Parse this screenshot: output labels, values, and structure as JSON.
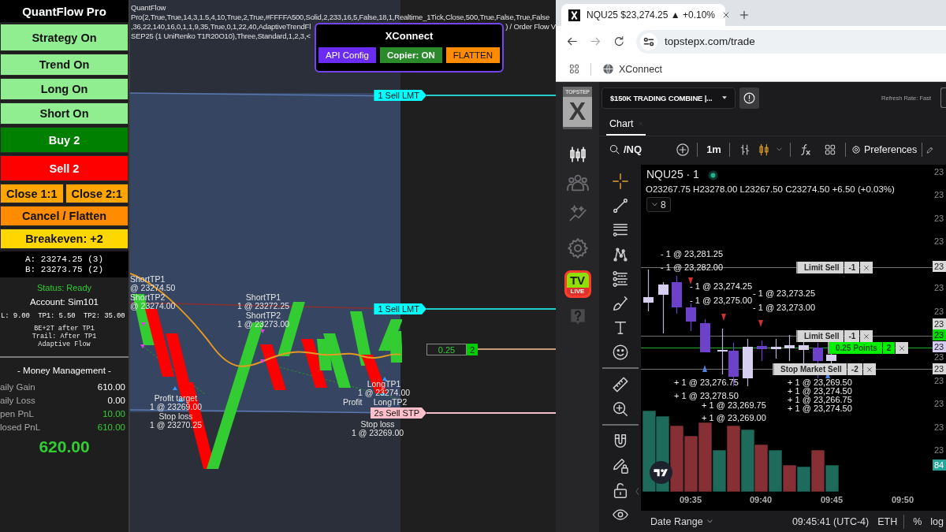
{
  "strategy_panel": {
    "title": "QuantFlow Pro",
    "button_rows": [
      {
        "buttons": [
          {
            "label": "Strategy On",
            "color": "#90ee90"
          }
        ]
      },
      {
        "buttons": [
          {
            "label": "Trend On",
            "color": "#90ee90"
          }
        ]
      },
      {
        "buttons": [
          {
            "label": "Long On",
            "color": "#90ee90"
          }
        ]
      },
      {
        "buttons": [
          {
            "label": "Short On",
            "color": "#90ee90"
          }
        ]
      },
      {
        "buttons": [
          {
            "label": "Buy 2",
            "color": "#008000"
          }
        ]
      },
      {
        "buttons": [
          {
            "label": "Sell 2",
            "color": "#ff0000"
          }
        ]
      },
      {
        "buttons": [
          {
            "label": "Close 1:1",
            "color": "#ffa500"
          },
          {
            "label": "Close 2:1",
            "color": "#ffa500"
          }
        ]
      },
      {
        "buttons": [
          {
            "label": "Cancel / Flatten",
            "color": "#ff8c00"
          }
        ]
      },
      {
        "buttons": [
          {
            "label": "Breakeven: +2",
            "color": "#ffd700"
          }
        ]
      }
    ],
    "quotes": [
      "A: 23274.25 (3)",
      "B: 23273.75 (2)"
    ],
    "status": "Status: Ready",
    "account": "Account: Sim101",
    "targets": "L: 9.00  TP1: 5.50  TP2: 35.00",
    "notes": [
      "BE+2T after TP1",
      "Trail: After TP1",
      "Adaptive Flow"
    ],
    "money_management": {
      "title": "- Money Management -",
      "rows": [
        {
          "label": "aily Gain",
          "value": "610.00",
          "color": "#ffffff"
        },
        {
          "label": "aily Loss",
          "value": "0.00",
          "color": "#ffffff"
        },
        {
          "label": "pen PnL",
          "value": "10.00",
          "color": "#32cd32"
        },
        {
          "label": "losed PnL",
          "value": "610.00",
          "color": "#32cd32"
        }
      ]
    },
    "total": "620.00"
  },
  "ninja_chart": {
    "indicator_lines": [
      [
        "QuantFlow"
      ],
      [
        "Pro(2,True,True,14,3,1.5,4,10,True,2,True,#FFFFA500,Solid,2,233,16,5,False,18,1,Realtime_1Tick,Close,500,True,False,True,False"
      ],
      [
        ",36,22,140,16,0,1,1,9,35,True,0,1,22,40,AdaptiveTrendFl",
        ") / Order Flow V"
      ],
      [
        "SEP25 (1 UniRenko T1R20O10),Three,Standard,1,2,3,<"
      ]
    ],
    "annotations": [
      {
        "title": "ShortTP1",
        "price": "@ 23274.50"
      },
      {
        "title": "ShortTP2",
        "price": "@ 23274.00"
      },
      {
        "title": "ShortTP1",
        "price": "1 @ 23272.25"
      },
      {
        "title": "ShortTP2",
        "price": "1 @ 23273.00"
      },
      {
        "title": "Profit target",
        "price": "1 @ 23269.00"
      },
      {
        "title": "Stop loss",
        "price": "1 @ 23270.25"
      },
      {
        "title": "LongTP1",
        "price": "1 @ 23274.00"
      },
      {
        "title": "Profit"
      },
      {
        "title": "LongTP2"
      },
      {
        "title": "Stop loss",
        "price": "1 @ 23269.00"
      }
    ],
    "orders": [
      {
        "kind": "limit",
        "label": "1 Sell LMT"
      },
      {
        "kind": "limit",
        "label": "1 Sell LMT"
      },
      {
        "kind": "position",
        "label": "0.25",
        "quantity": "2"
      },
      {
        "kind": "stop",
        "label": "2s Sell STP"
      }
    ]
  },
  "xconnect": {
    "title": "XConnect",
    "buttons": [
      {
        "label": "API Config",
        "color": "#6a2cf2"
      },
      {
        "label": "Copier: ON",
        "color": "#2b8a2b"
      },
      {
        "label": "FLATTEN",
        "color": "#ff8c00"
      }
    ]
  },
  "browser": {
    "tab": {
      "title": "NQU25 $23,274.25 ▲ +0.10%"
    },
    "url": "topstepx.com/trade",
    "bookmarks": [
      "XConnect"
    ]
  },
  "topstepx": {
    "logo": {
      "top": "TOPSTEP",
      "mark": "X"
    },
    "live_badge": {
      "top": "TV",
      "bottom": "LIVE"
    },
    "account": "$150K TRADING COMBINE |...",
    "refresh_rate": "Refresh Rate: Fast",
    "tabs": [
      {
        "label": "Chart",
        "selected": true
      }
    ],
    "toolbar": {
      "symbol": "/NQ",
      "interval": "1m",
      "preferences": "Preferences"
    },
    "chart": {
      "title": "NQU25 · 1",
      "ohlc": "O23267.75 H23278.00 L23267.50 C23274.50 +6.50 (+0.03%)",
      "indicators": "8",
      "fills": [
        "- 1 @ 23,281.25",
        "- 1 @ 23,282.00",
        "- 1 @ 23,274.25",
        "- 1 @ 23,273.25",
        "- 1 @ 23,275.00",
        "- 1 @ 23,273.00",
        "+ 1 @ 23,276.75",
        "+ 1 @ 23,278.50",
        "+ 1 @ 23,269.75",
        "+ 1 @ 23,269.00",
        "+ 1 @ 23,269.50",
        "+ 1 @ 23,274.50",
        "+ 1 @ 23,266.75",
        "+ 1 @ 23,274.50"
      ],
      "orders": [
        {
          "kind": "limit",
          "label": "Limit Sell",
          "quantity": "-1"
        },
        {
          "kind": "limit",
          "label": "Limit Sell",
          "quantity": "-1"
        },
        {
          "kind": "position",
          "label": "0.25 Points",
          "quantity": "2"
        },
        {
          "kind": "stop",
          "label": "Stop Market Sell",
          "quantity": "-2"
        }
      ],
      "price_labels": [
        {
          "text": "23",
          "kind": "plain"
        },
        {
          "text": "23",
          "kind": "plain"
        },
        {
          "text": "23",
          "kind": "plain"
        },
        {
          "text": "23",
          "kind": "plain"
        },
        {
          "text": "23",
          "kind": "box"
        },
        {
          "text": "23",
          "kind": "plain"
        },
        {
          "text": "23",
          "kind": "plain"
        },
        {
          "text": "23",
          "kind": "box"
        },
        {
          "text": "23",
          "kind": "green"
        },
        {
          "text": "23",
          "kind": "lavender"
        },
        {
          "text": "23",
          "kind": "plain"
        },
        {
          "text": "23",
          "kind": "box"
        },
        {
          "text": "23",
          "kind": "plain"
        },
        {
          "text": "23",
          "kind": "plain"
        },
        {
          "text": "23",
          "kind": "plain"
        },
        {
          "text": "23",
          "kind": "plain"
        },
        {
          "text": "84",
          "kind": "volume"
        }
      ],
      "time_labels": [
        "09:35",
        "09:40",
        "09:45",
        "09:50"
      ]
    },
    "bottom_bar": {
      "date_range": "Date Range",
      "clock": "09:45:41 (UTC-4)",
      "session": "ETH",
      "percent": "%",
      "log": "log"
    }
  }
}
